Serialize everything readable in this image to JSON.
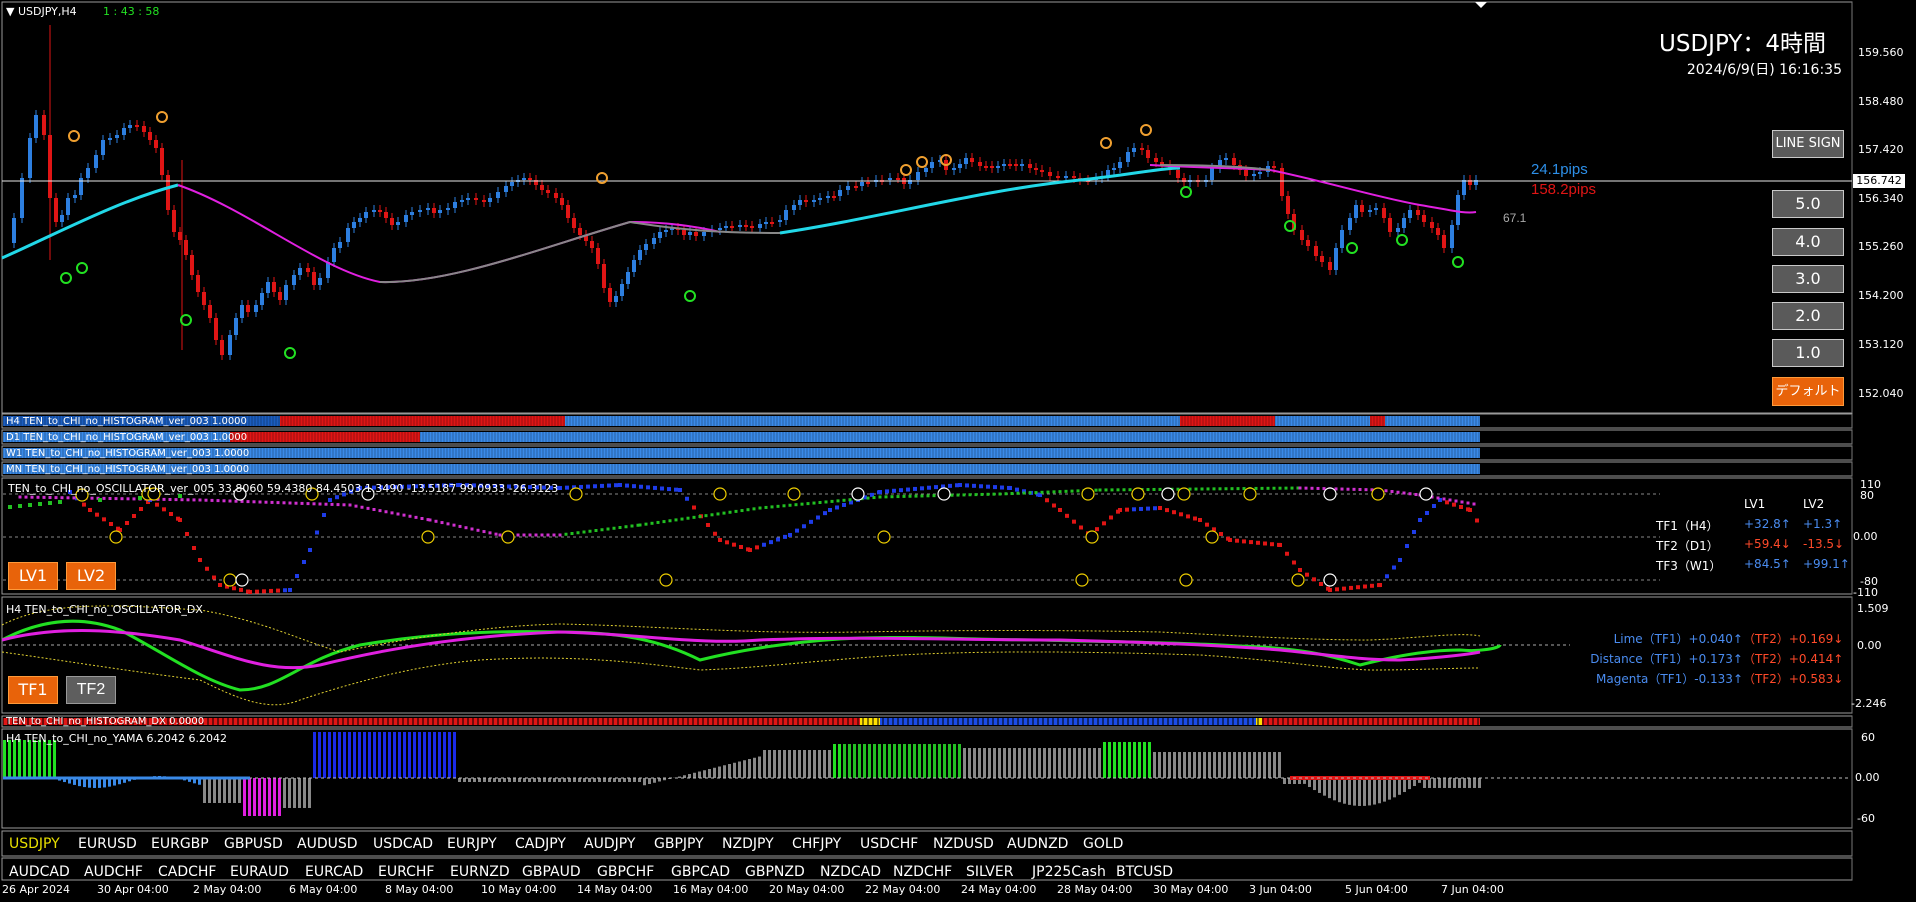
{
  "header": {
    "symbol_tf": "USDJPY,H4",
    "countdown": "1 : 43 : 58",
    "title": "USDJPY：4時間",
    "datetime": "2024/6/9(日) 16:16:35"
  },
  "price_axis": [
    "159.560",
    "158.480",
    "157.420",
    "156.340",
    "155.260",
    "154.200",
    "153.120",
    "152.040"
  ],
  "current_price": "156.742",
  "pips_up": "24.1pips",
  "pips_down": "158.2pips",
  "ma_value": "67.1",
  "right_buttons": {
    "line_sign": "LINE SIGN",
    "levels": [
      "5.0",
      "4.0",
      "3.0",
      "2.0",
      "1.0"
    ],
    "default": "デフォルト"
  },
  "histograms": [
    "H4 TEN_to_CHI_no_HISTOGRAM_ver_003 1.0000",
    "D1 TEN_to_CHI_no_HISTOGRAM_ver_003 1.0000",
    "W1 TEN_to_CHI_no_HISTOGRAM_ver_003 1.0000",
    "MN TEN_to_CHI_no_HISTOGRAM_ver_003 1.0000"
  ],
  "oscillator": {
    "label": "TEN_to_CHI_no_OSCILLATOR_ver_005 33.8060 59.4380 84.4503 1.3490 -13.5187 99.0933 -26.3123",
    "axis": [
      "110",
      "80",
      "0.00",
      "-80",
      "-110"
    ],
    "buttons": [
      "LV1",
      "LV2"
    ],
    "col_headers": [
      "LV1",
      "LV2"
    ],
    "rows": [
      {
        "tf": "TF1（H4）",
        "lv1": "+32.8↑",
        "lv2": "+1.3↑"
      },
      {
        "tf": "TF2（D1）",
        "lv1": "+59.4↓",
        "lv2": "-13.5↓"
      },
      {
        "tf": "TF3（W1）",
        "lv1": "+84.5↑",
        "lv2": "+99.1↑"
      }
    ]
  },
  "dx": {
    "label": "H4 TEN_to_CHI_no_OSCILLATOR_DX",
    "axis": [
      "1.509",
      "0.00",
      "-2.246"
    ],
    "buttons": [
      "TF1",
      "TF2"
    ],
    "rows": [
      {
        "name": "Lime（TF1）+0.040↑",
        "tf2": "（TF2）+0.169↓"
      },
      {
        "name": "Distance（TF1）+0.173↑",
        "tf2": "（TF2）+0.414↑"
      },
      {
        "name": "Magenta（TF1）-0.133↑",
        "tf2": "（TF2）+0.583↓"
      }
    ]
  },
  "hist_dx_label": "TEN_to_CHI_no_HISTOGRAM_DX 0.0000",
  "yama": {
    "label": "H4 TEN_to_CHI_no_YAMA 6.2042 6.2042",
    "axis": [
      "60",
      "0.00",
      "-60"
    ]
  },
  "symbols_row1": [
    "USDJPY",
    "EURUSD",
    "EURGBP",
    "GBPUSD",
    "AUDUSD",
    "USDCAD",
    "EURJPY",
    "CADJPY",
    "AUDJPY",
    "GBPJPY",
    "NZDJPY",
    "CHFJPY",
    "USDCHF",
    "NZDUSD",
    "AUDNZD",
    "GOLD"
  ],
  "symbols_row2": [
    "AUDCAD",
    "AUDCHF",
    "CADCHF",
    "EURAUD",
    "EURCAD",
    "EURCHF",
    "EURNZD",
    "GBPAUD",
    "GBPCHF",
    "GBPCAD",
    "GBPNZD",
    "NZDCAD",
    "NZDCHF",
    "SILVER",
    "JP225Cash",
    "BTCUSD"
  ],
  "dates": [
    "26 Apr 2024",
    "30 Apr 04:00",
    "2 May 04:00",
    "6 May 04:00",
    "8 May 04:00",
    "10 May 04:00",
    "14 May 04:00",
    "16 May 04:00",
    "20 May 04:00",
    "22 May 04:00",
    "24 May 04:00",
    "28 May 04:00",
    "30 May 04:00",
    "3 Jun 04:00",
    "5 Jun 04:00",
    "7 Jun 04:00"
  ],
  "colors": {
    "bull": "#2d7fe0",
    "bear": "#e01515",
    "cyan": "#22d8e8",
    "magenta": "#e020e0",
    "lime": "#22e022",
    "orange": "#e8630a"
  }
}
